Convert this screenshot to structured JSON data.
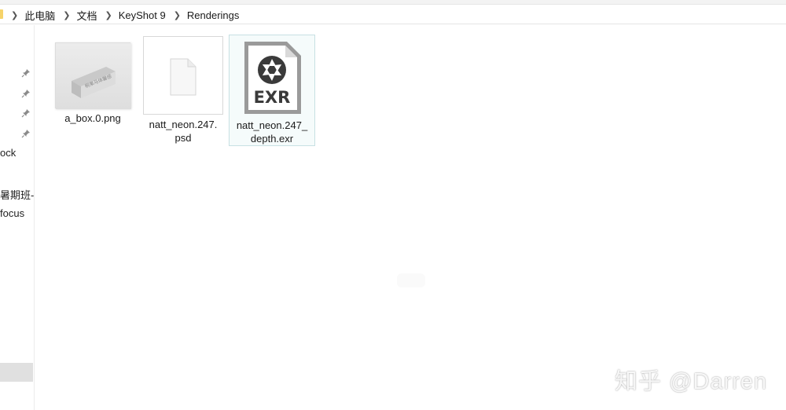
{
  "breadcrumb": [
    "此电脑",
    "文档",
    "KeyShot 9",
    "Renderings"
  ],
  "nav": {
    "items": [
      "ock",
      "暑期班-",
      "focus"
    ]
  },
  "files": [
    {
      "name": "a_box.0.png",
      "type": "png",
      "selected": false
    },
    {
      "name": "natt_neon.247.psd",
      "line1": "natt_neon.247.",
      "line2": "psd",
      "type": "psd",
      "selected": false
    },
    {
      "name": "natt_neon.247_depth.exr",
      "line1": "natt_neon.247_",
      "line2": "depth.exr",
      "type": "exr",
      "selected": true
    }
  ],
  "exr_icon_text": "EXR",
  "box_thumbnail_text": "桐果马体馨感",
  "watermark": "知乎 @Darren",
  "colors": {
    "selection_border": "#c7e0e3",
    "selection_fill": "#f5fbfb",
    "folder_yellow": "#f6d36a",
    "exr_icon_gray": "#9a9a9a",
    "exr_glyph": "#3a3a3a"
  },
  "icons": [
    "chevron-right-icon",
    "pin-icon",
    "exr-file-icon",
    "psd-file-icon",
    "png-thumbnail"
  ]
}
